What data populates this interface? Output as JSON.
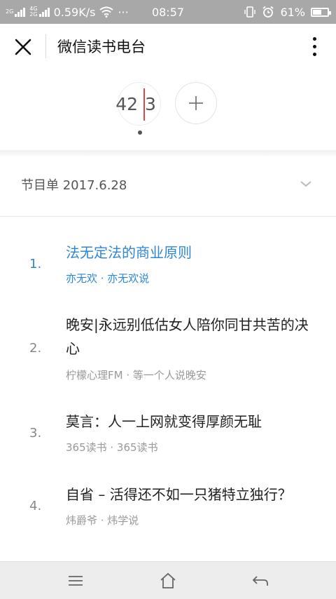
{
  "status_bar": {
    "net_label_1": "2G",
    "net_label_2": "4G",
    "net_label_3": "2G",
    "speed": "0.59K/s",
    "dots": "···",
    "time": "08:57",
    "battery_text": "61%",
    "battery_level": 0.61
  },
  "header": {
    "title": "微信读书电台"
  },
  "player": {
    "count_left": "42",
    "count_right": "3"
  },
  "program": {
    "label": "节目单 2017.6.28"
  },
  "items": [
    {
      "index": "1.",
      "title": "法无定法的商业原则",
      "meta": "亦无欢 · 亦无欢说"
    },
    {
      "index": "2.",
      "title": "晚安|永远别低估女人陪你同甘共苦的决心",
      "meta": "柠檬心理FM · 等一个人说晚安"
    },
    {
      "index": "3.",
      "title": "莫言：人一上网就变得厚颜无耻",
      "meta": "365读书 · 365读书"
    },
    {
      "index": "4.",
      "title": "自省 – 活得还不如一只猪特立独行？",
      "meta": "炜爵爷 · 炜学说"
    }
  ],
  "colors": {
    "accent": "#2e86d8",
    "status_bg": "#a8a8a8",
    "red_line": "#e04646"
  }
}
